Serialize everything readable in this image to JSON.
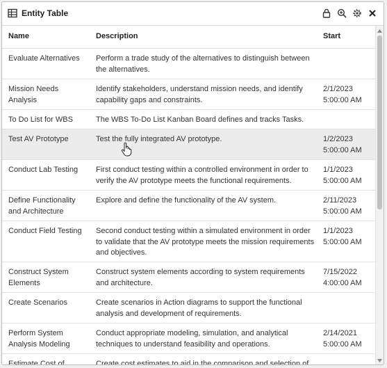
{
  "window": {
    "title": "Entity Table",
    "title_icon": "table-icon",
    "actions": [
      "lock-icon",
      "zoom-icon",
      "gear-icon",
      "close-icon"
    ]
  },
  "columns": {
    "name": "Name",
    "description": "Description",
    "start": "Start"
  },
  "rows": [
    {
      "name": "Evaluate Alternatives",
      "description": "Perform a trade study of the alternatives to distinguish between the alternatives.",
      "start": ""
    },
    {
      "name": "Mission Needs Analysis",
      "description": "Identify stakeholders, understand mission needs, and identify capability gaps and constraints.",
      "start": "2/1/2023 5:00:00 AM"
    },
    {
      "name": "To Do List for WBS",
      "description": "The WBS To-Do List Kanban Board defines and tracks Tasks.",
      "start": ""
    },
    {
      "name": "Test AV Prototype",
      "description": "Test the fully integrated AV prototype.",
      "start": "1/2/2023 5:00:00 AM"
    },
    {
      "name": "Conduct Lab Testing",
      "description": "First conduct testing within a controlled environment in order to verify the AV prototype meets the functional requirements.",
      "start": "1/1/2023 5:00:00 AM"
    },
    {
      "name": "Define Functionality and Architecture",
      "description": "Explore and define the functionality of the AV system.",
      "start": "2/11/2023 5:00:00 AM"
    },
    {
      "name": "Conduct Field Testing",
      "description": "Second conduct testing within a simulated environment in order to validate that the AV prototype meets the mission requirements and objectives.",
      "start": "1/1/2023 5:00:00 AM"
    },
    {
      "name": "Construct System Elements",
      "description": "Construct system elements according to system requirements and architecture.",
      "start": "7/15/2022 4:00:00 AM"
    },
    {
      "name": "Create Scenarios",
      "description": "Create scenarios in Action diagrams to support the functional analysis and development of requirements.",
      "start": ""
    },
    {
      "name": "Perform System Analysis Modeling",
      "description": "Conduct appropriate modeling, simulation, and analytical techniques to understand feasibility and operations.",
      "start": "2/14/2021 5:00:00 AM"
    },
    {
      "name": "Estimate Cost of",
      "description": "Create cost estimates to aid in the comparison and selection of",
      "start": ""
    }
  ],
  "hovered_row": 3
}
